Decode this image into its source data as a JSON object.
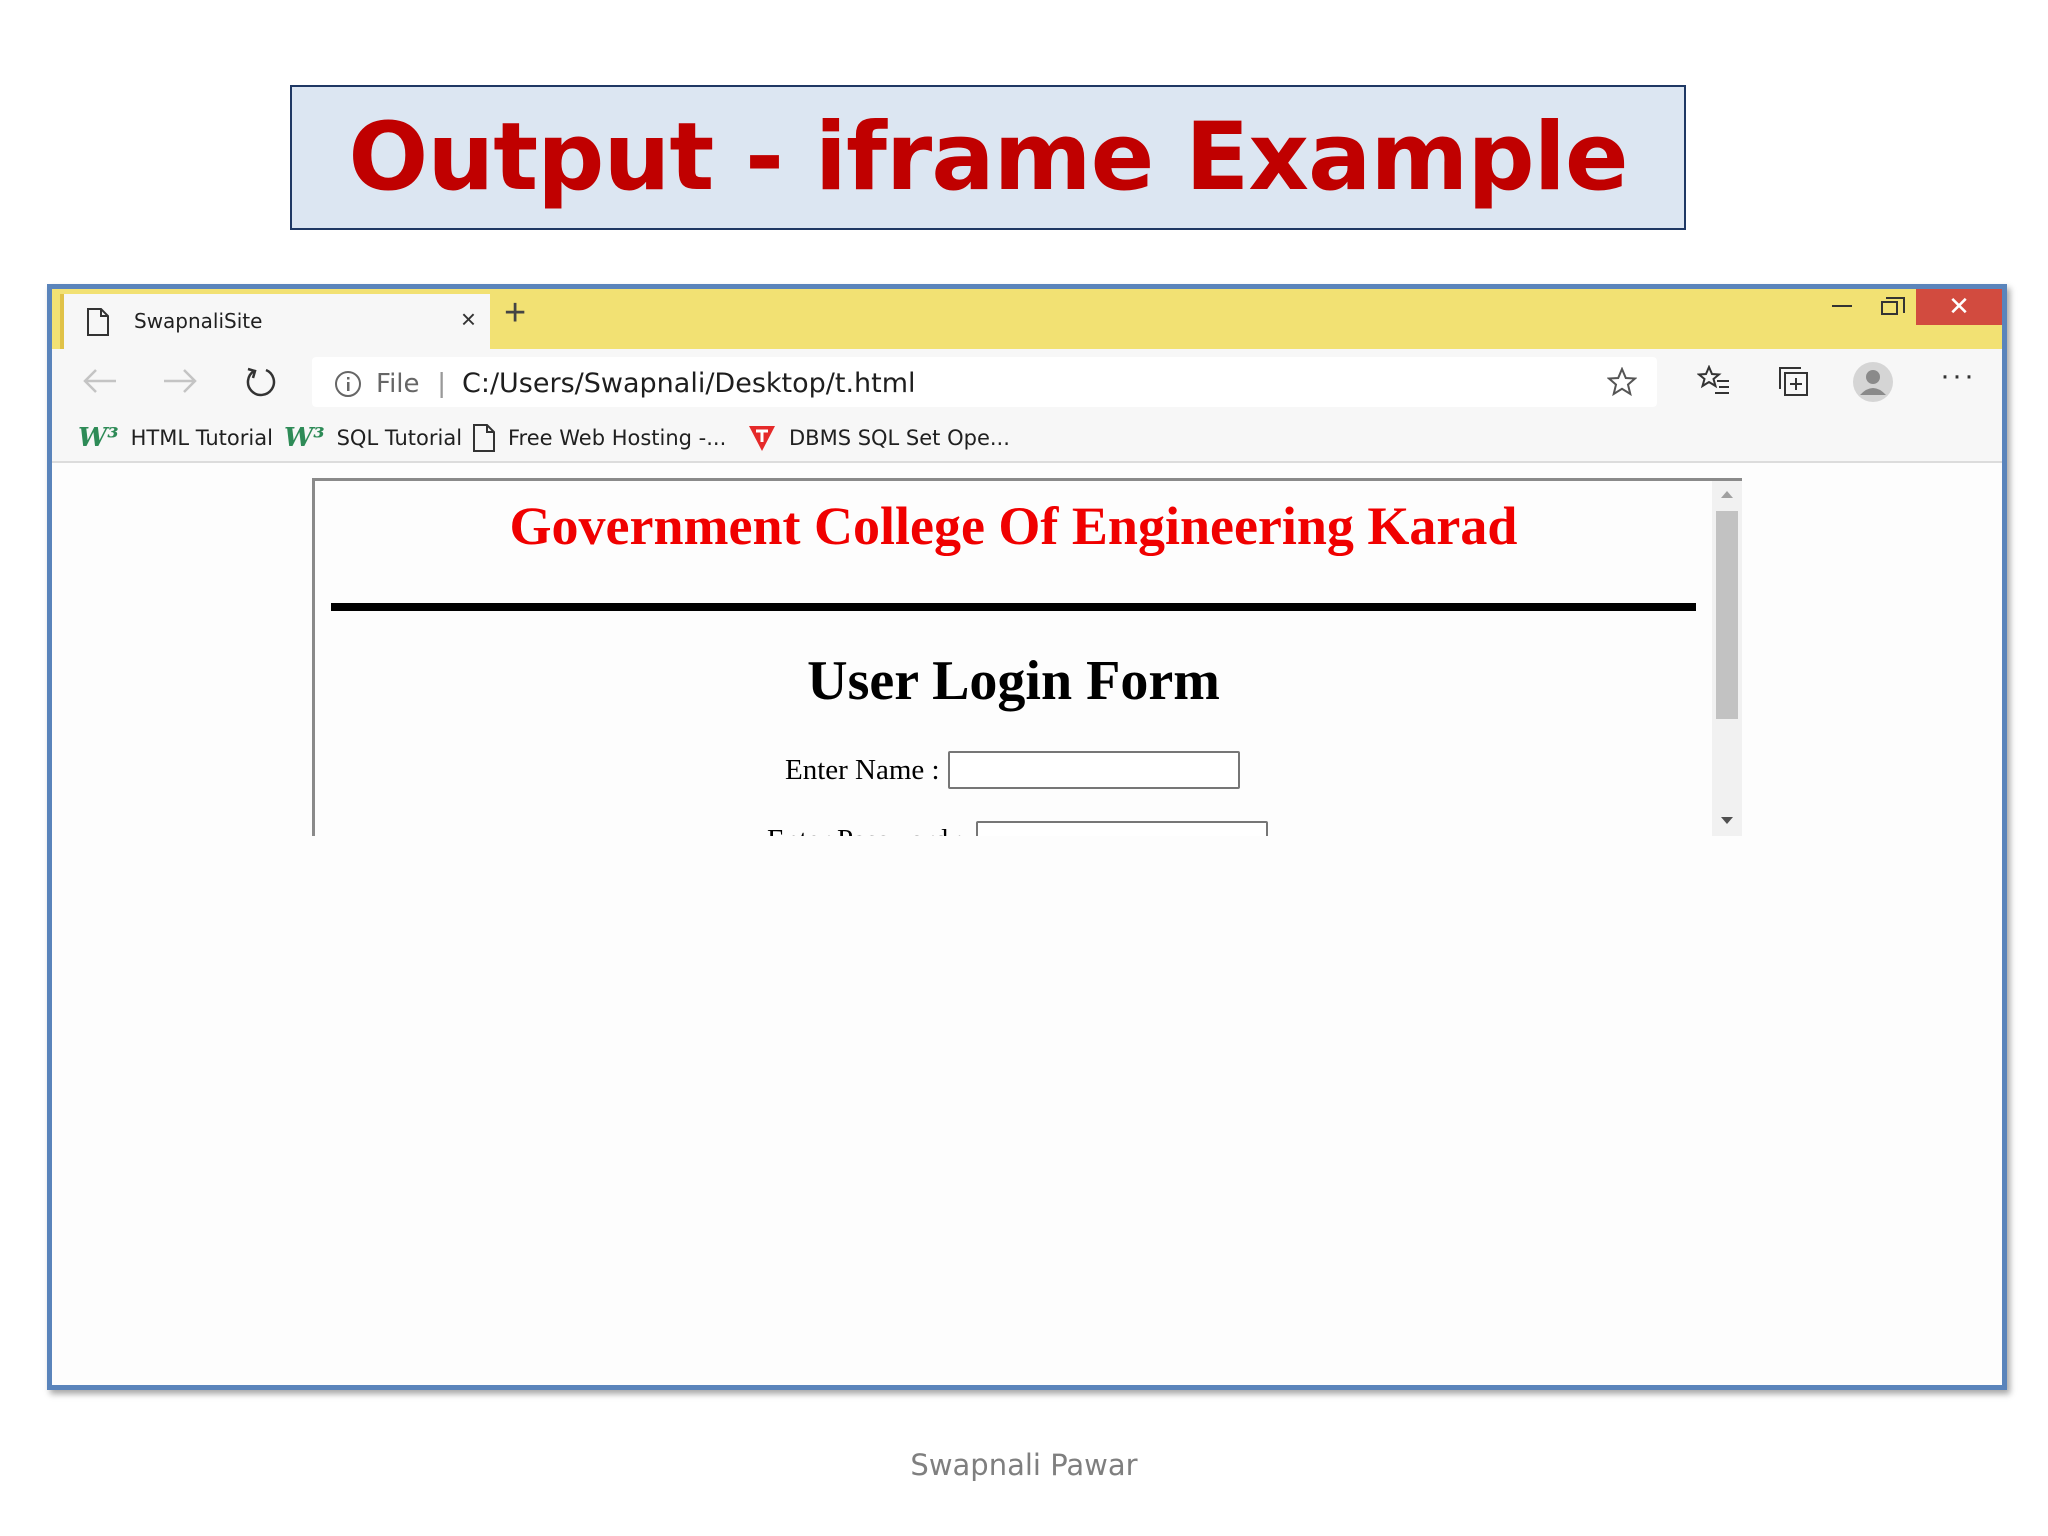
{
  "slide": {
    "title": "Output - iframe Example",
    "footer": "Swapnali Pawar"
  },
  "browser": {
    "tab": {
      "title": "SwapnaliSite",
      "close": "×"
    },
    "new_tab": "+",
    "window_close": "✕",
    "address": {
      "scheme_label": "File",
      "separator": "|",
      "url": "C:/Users/Swapnali/Desktop/t.html"
    },
    "more_menu": "···",
    "bookmarks": [
      {
        "label": "HTML Tutorial",
        "icon": "w3schools-icon",
        "icon_text": "W³"
      },
      {
        "label": "SQL Tutorial",
        "icon": "w3schools-icon",
        "icon_text": "W³"
      },
      {
        "label": "Free Web Hosting -...",
        "icon": "page-icon"
      },
      {
        "label": "DBMS SQL Set Ope...",
        "icon": "tutorialspoint-icon"
      }
    ],
    "accent_colors": {
      "tabbar": "#f2e173",
      "frame": "#5a84bb",
      "close": "#d24b3f"
    }
  },
  "iframe": {
    "college": "Government College Of Engineering Karad",
    "form_title": "User Login Form",
    "name_label": "Enter Name :",
    "password_label": "Enter Password :",
    "name_value": "",
    "password_value": ""
  }
}
